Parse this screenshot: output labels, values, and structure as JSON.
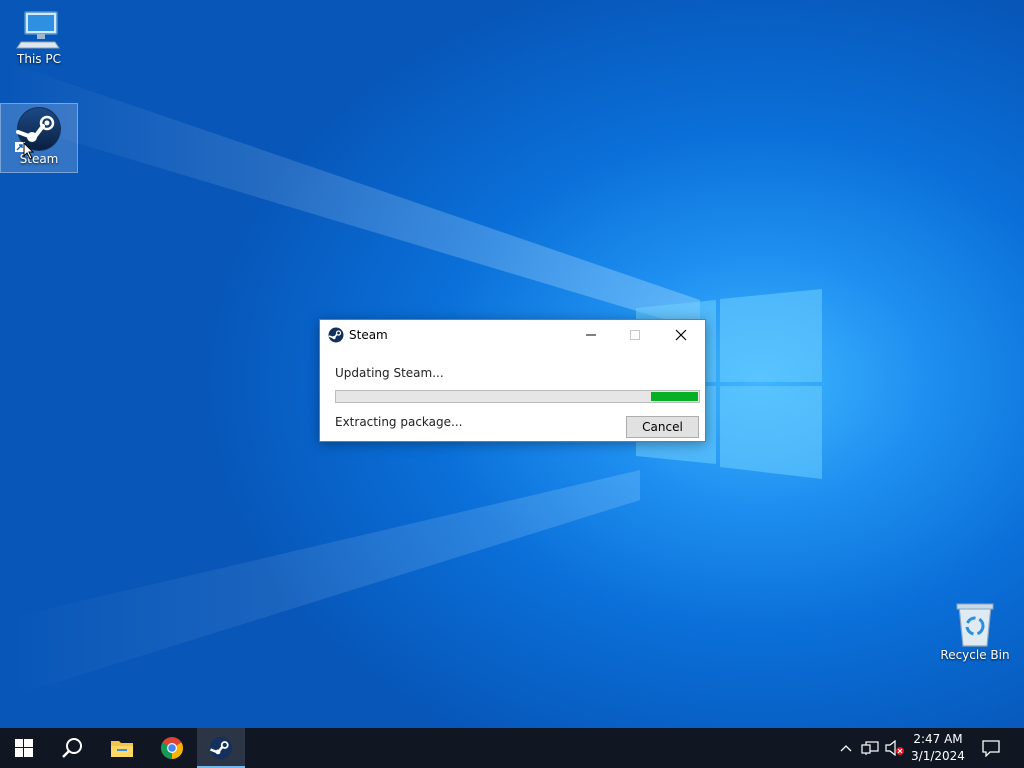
{
  "desktop": {
    "icons": [
      {
        "label": "This PC",
        "icon": "computer-icon"
      },
      {
        "label": "Steam",
        "icon": "steam-icon"
      },
      {
        "label": "Recycle Bin",
        "icon": "recycle-bin-icon"
      }
    ]
  },
  "dialog": {
    "title": "Steam",
    "status": "Updating Steam...",
    "progress_fraction": 0.13,
    "substatus": "Extracting package...",
    "cancel_label": "Cancel",
    "progress_color": "#06b025"
  },
  "taskbar": {
    "items": [
      {
        "icon": "windows-start-icon"
      },
      {
        "icon": "search-icon"
      },
      {
        "icon": "file-explorer-icon"
      },
      {
        "icon": "chrome-icon"
      },
      {
        "icon": "steam-icon",
        "active": true
      }
    ],
    "tray": {
      "icons": [
        "chevron-up-icon",
        "network-icon",
        "volume-muted-icon",
        "notifications-icon"
      ]
    },
    "clock": {
      "time": "2:47 AM",
      "date": "3/1/2024"
    }
  },
  "colors": {
    "taskbar_bg": "#101722",
    "desktop_accent": "#0a6fd8"
  }
}
